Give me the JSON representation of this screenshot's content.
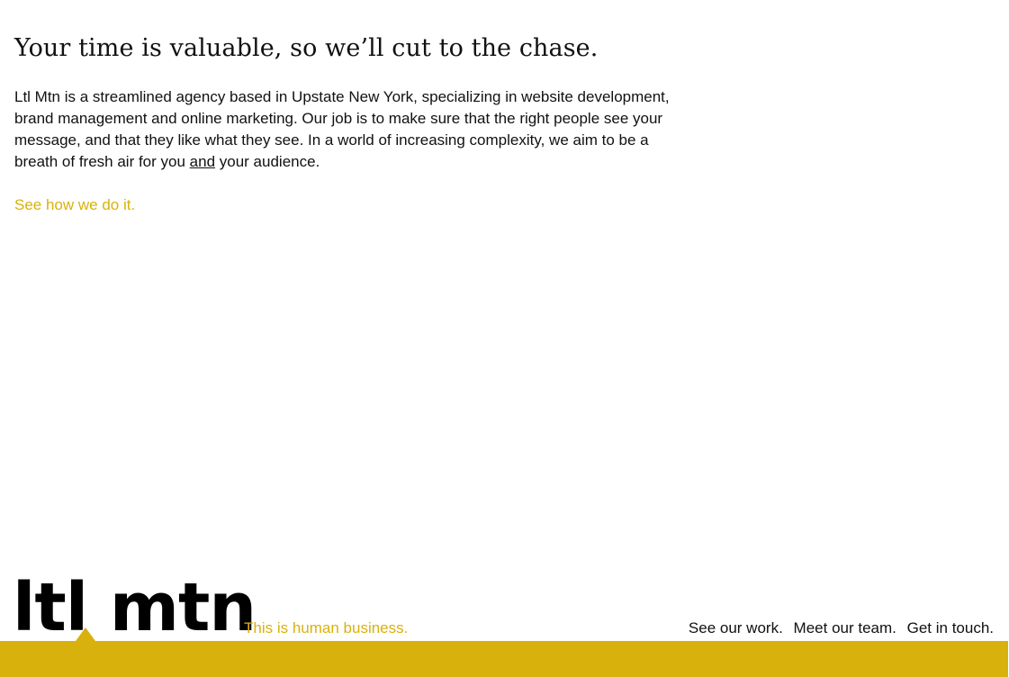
{
  "main": {
    "headline": "Your time is valuable, so we’ll cut to the chase.",
    "intro_before": "Ltl Mtn is a streamlined agency based in Upstate New York, specializing in website development, brand management and online marketing. Our job is to make sure that the right people see your message, and that they like what they see. In a world of increasing complexity, we aim to be a breath of fresh air for you ",
    "intro_emphasis": "and",
    "intro_after": " your audience.",
    "cta_label": "See how we do it."
  },
  "footer": {
    "logo_text": "ltl mtn",
    "tagline": "This is human business.",
    "nav": [
      {
        "label": "See our work."
      },
      {
        "label": "Meet our team."
      },
      {
        "label": "Get in touch."
      }
    ]
  },
  "colors": {
    "accent": "#d9b10c",
    "text": "#111111",
    "background": "#ffffff"
  }
}
